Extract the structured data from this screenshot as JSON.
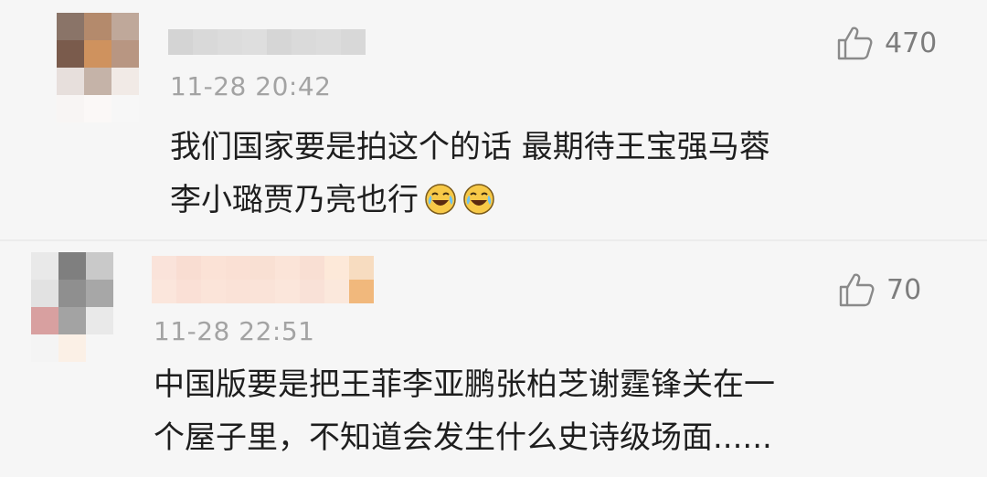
{
  "comments": [
    {
      "timestamp": "11-28 20:42",
      "likes": "470",
      "line1": "我们国家要是拍这个的话 最期待王宝强马蓉",
      "line2": "李小璐贾乃亮也行",
      "emojis": [
        "laugh-cry-emoji",
        "laugh-cry-emoji"
      ],
      "avatar_colors": [
        "#8a7468",
        "#b48a6c",
        "#bfa89a",
        "#7a5b4c",
        "#cf925e",
        "#b89682",
        "#e7dfdc",
        "#c5b3a8",
        "#f1eae6",
        "#f8f5f4",
        "#fbf8f7",
        "#f7f7f7"
      ],
      "username_colors": [
        "#d4d4d4",
        "#d9d9d9",
        "#dcdcdc",
        "#dedede",
        "#d6d6d6",
        "#dadada",
        "#dcdcdc",
        "#d8d8d8"
      ]
    },
    {
      "timestamp": "11-28 22:51",
      "likes": "70",
      "line1": "中国版要是把王菲李亚鹏张柏芝谢霆锋关在一",
      "line2": "个屋子里，不知道会发生什么史诗级场面......",
      "avatar_colors": [
        "#e9e9e9",
        "#7f7f7f",
        "#c9c9c9",
        "#e2e2e2",
        "#8f8f8f",
        "#a7a7a7",
        "#d8a0a0",
        "#a3a3a3",
        "#e9e9e9",
        "#f4f4f4",
        "#fbf0e6",
        "#f6f6f6"
      ],
      "username_colors_top": [
        "#fae3da",
        "#f9ddd2",
        "#fbe2d6",
        "#fae0d4",
        "#f9e0d3",
        "#fbe4d8",
        "#f9dfd3",
        "#fde9d9",
        "#f7dcc0"
      ],
      "username_colors_bottom": [
        "#fbe6dc",
        "#fae0d6",
        "#fbe4d9",
        "#fae2d7",
        "#fae3d8",
        "#fbe6db",
        "#f9e1d7",
        "#fbe8dc",
        "#f1b87c"
      ]
    }
  ],
  "colors": {
    "background": "#f6f6f6",
    "meta_gray": "#a3a3a3",
    "like_gray": "#7d7d7d",
    "text": "#1e1e1e",
    "emoji_face": "#f7c948"
  }
}
